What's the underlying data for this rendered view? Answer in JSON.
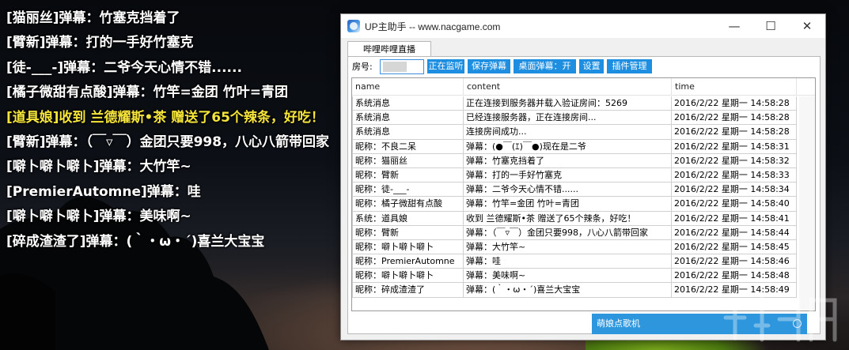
{
  "danmaku": [
    {
      "text": "[猫丽丝]弹幕：竹塞克挡着了",
      "gift": false
    },
    {
      "text": "[臂新]弹幕：打的一手好竹塞克",
      "gift": false
    },
    {
      "text": "[徒-___-]弹幕：二爷今天心情不错......",
      "gift": false
    },
    {
      "text": "[橘子微甜有点酸]弹幕：竹竿=金团  竹叶=青团",
      "gift": false
    },
    {
      "text": "[道具娘]收到 兰德耀斯•茶 赠送了65个辣条，好吃！",
      "gift": true
    },
    {
      "text": "[臂新]弹幕：（￣▿￣）金团只要998，八心八箭带回家",
      "gift": false
    },
    {
      "text": "[噼卜噼卜噼卜]弹幕：大竹竿~",
      "gift": false
    },
    {
      "text": "[PremierAutomne]弹幕：哇",
      "gift": false
    },
    {
      "text": "[噼卜噼卜噼卜]弹幕：美味啊~",
      "gift": false
    },
    {
      "text": "[碎成渣渣了]弹幕：(｀・ω・´)喜兰大宝宝",
      "gift": false
    }
  ],
  "window": {
    "title": "UP主助手 -- www.nacgame.com",
    "controls": {
      "minimize": "—",
      "maximize": "☐",
      "close": "✕"
    },
    "tab_label": "哔哩哔哩直播"
  },
  "toolbar": {
    "room_label": "房号:",
    "room_value": "",
    "buttons": {
      "monitor": "正在监听",
      "save": "保存弹幕",
      "desk": "桌面弹幕：开",
      "settings": "设置",
      "plugins": "插件管理"
    }
  },
  "table": {
    "columns": {
      "name": "name",
      "content": "content",
      "time": "time"
    },
    "rows": [
      {
        "name": "系统消息",
        "content": "正在连接到服务器并载入验证房间：5269",
        "time": "2016/2/22 星期一 14:58:28"
      },
      {
        "name": "系统消息",
        "content": "已经连接服务器，正在连接房间...",
        "time": "2016/2/22 星期一 14:58:28"
      },
      {
        "name": "系统消息",
        "content": "连接房间成功...",
        "time": "2016/2/22 星期一 14:58:28"
      },
      {
        "name": "昵称：不良二呆",
        "content": "弹幕：(●￣(ｴ)￣●)现在是二爷",
        "time": "2016/2/22 星期一 14:58:31"
      },
      {
        "name": "昵称：猫丽丝",
        "content": "弹幕：竹塞克挡着了",
        "time": "2016/2/22 星期一 14:58:32"
      },
      {
        "name": "昵称：臂新",
        "content": "弹幕：打的一手好竹塞克",
        "time": "2016/2/22 星期一 14:58:33"
      },
      {
        "name": "昵称：徒-___-",
        "content": "弹幕：二爷今天心情不错......",
        "time": "2016/2/22 星期一 14:58:34"
      },
      {
        "name": "昵称：橘子微甜有点酸",
        "content": "弹幕：竹竿=金团  竹叶=青团",
        "time": "2016/2/22 星期一 14:58:40"
      },
      {
        "name": "系统：道具娘",
        "content": "收到 兰德耀斯•茶 赠送了65个辣条，好吃！",
        "time": "2016/2/22 星期一 14:58:41"
      },
      {
        "name": "昵称：臂新",
        "content": "弹幕：（￣▿￣）金团只要998，八心八箭带回家",
        "time": "2016/2/22 星期一 14:58:44"
      },
      {
        "name": "昵称：噼卜噼卜噼卜",
        "content": "弹幕：大竹竿~",
        "time": "2016/2/22 星期一 14:58:45"
      },
      {
        "name": "昵称：PremierAutomne",
        "content": "弹幕：哇",
        "time": "2016/2/22 星期一 14:58:46"
      },
      {
        "name": "昵称：噼卜噼卜噼卜",
        "content": "弹幕：美味啊~",
        "time": "2016/2/22 星期一 14:58:48"
      },
      {
        "name": "昵称：碎成渣渣了",
        "content": "弹幕：(｀・ω・´)喜兰大宝宝",
        "time": "2016/2/22 星期一 14:58:49"
      }
    ]
  },
  "popup": {
    "label": "萌娘点歌机"
  },
  "icons": {
    "app": "app-logo-icon",
    "popup": "circle-icon",
    "watermark": "watermark-logo"
  },
  "colors": {
    "accent": "#1e8fe0",
    "gift_text": "#f5e43a",
    "popup": "#2d96dc"
  }
}
